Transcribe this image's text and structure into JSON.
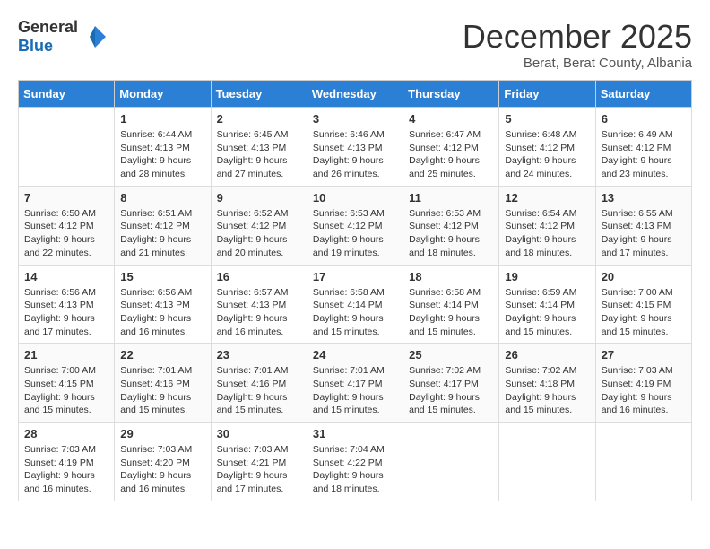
{
  "header": {
    "logo_general": "General",
    "logo_blue": "Blue",
    "title": "December 2025",
    "subtitle": "Berat, Berat County, Albania"
  },
  "weekdays": [
    "Sunday",
    "Monday",
    "Tuesday",
    "Wednesday",
    "Thursday",
    "Friday",
    "Saturday"
  ],
  "weeks": [
    [
      {
        "day": "",
        "empty": true
      },
      {
        "day": "1",
        "sunrise": "6:44 AM",
        "sunset": "4:13 PM",
        "daylight": "9 hours and 28 minutes."
      },
      {
        "day": "2",
        "sunrise": "6:45 AM",
        "sunset": "4:13 PM",
        "daylight": "9 hours and 27 minutes."
      },
      {
        "day": "3",
        "sunrise": "6:46 AM",
        "sunset": "4:13 PM",
        "daylight": "9 hours and 26 minutes."
      },
      {
        "day": "4",
        "sunrise": "6:47 AM",
        "sunset": "4:12 PM",
        "daylight": "9 hours and 25 minutes."
      },
      {
        "day": "5",
        "sunrise": "6:48 AM",
        "sunset": "4:12 PM",
        "daylight": "9 hours and 24 minutes."
      },
      {
        "day": "6",
        "sunrise": "6:49 AM",
        "sunset": "4:12 PM",
        "daylight": "9 hours and 23 minutes."
      }
    ],
    [
      {
        "day": "7",
        "sunrise": "6:50 AM",
        "sunset": "4:12 PM",
        "daylight": "9 hours and 22 minutes."
      },
      {
        "day": "8",
        "sunrise": "6:51 AM",
        "sunset": "4:12 PM",
        "daylight": "9 hours and 21 minutes."
      },
      {
        "day": "9",
        "sunrise": "6:52 AM",
        "sunset": "4:12 PM",
        "daylight": "9 hours and 20 minutes."
      },
      {
        "day": "10",
        "sunrise": "6:53 AM",
        "sunset": "4:12 PM",
        "daylight": "9 hours and 19 minutes."
      },
      {
        "day": "11",
        "sunrise": "6:53 AM",
        "sunset": "4:12 PM",
        "daylight": "9 hours and 18 minutes."
      },
      {
        "day": "12",
        "sunrise": "6:54 AM",
        "sunset": "4:12 PM",
        "daylight": "9 hours and 18 minutes."
      },
      {
        "day": "13",
        "sunrise": "6:55 AM",
        "sunset": "4:13 PM",
        "daylight": "9 hours and 17 minutes."
      }
    ],
    [
      {
        "day": "14",
        "sunrise": "6:56 AM",
        "sunset": "4:13 PM",
        "daylight": "9 hours and 17 minutes."
      },
      {
        "day": "15",
        "sunrise": "6:56 AM",
        "sunset": "4:13 PM",
        "daylight": "9 hours and 16 minutes."
      },
      {
        "day": "16",
        "sunrise": "6:57 AM",
        "sunset": "4:13 PM",
        "daylight": "9 hours and 16 minutes."
      },
      {
        "day": "17",
        "sunrise": "6:58 AM",
        "sunset": "4:14 PM",
        "daylight": "9 hours and 15 minutes."
      },
      {
        "day": "18",
        "sunrise": "6:58 AM",
        "sunset": "4:14 PM",
        "daylight": "9 hours and 15 minutes."
      },
      {
        "day": "19",
        "sunrise": "6:59 AM",
        "sunset": "4:14 PM",
        "daylight": "9 hours and 15 minutes."
      },
      {
        "day": "20",
        "sunrise": "7:00 AM",
        "sunset": "4:15 PM",
        "daylight": "9 hours and 15 minutes."
      }
    ],
    [
      {
        "day": "21",
        "sunrise": "7:00 AM",
        "sunset": "4:15 PM",
        "daylight": "9 hours and 15 minutes."
      },
      {
        "day": "22",
        "sunrise": "7:01 AM",
        "sunset": "4:16 PM",
        "daylight": "9 hours and 15 minutes."
      },
      {
        "day": "23",
        "sunrise": "7:01 AM",
        "sunset": "4:16 PM",
        "daylight": "9 hours and 15 minutes."
      },
      {
        "day": "24",
        "sunrise": "7:01 AM",
        "sunset": "4:17 PM",
        "daylight": "9 hours and 15 minutes."
      },
      {
        "day": "25",
        "sunrise": "7:02 AM",
        "sunset": "4:17 PM",
        "daylight": "9 hours and 15 minutes."
      },
      {
        "day": "26",
        "sunrise": "7:02 AM",
        "sunset": "4:18 PM",
        "daylight": "9 hours and 15 minutes."
      },
      {
        "day": "27",
        "sunrise": "7:03 AM",
        "sunset": "4:19 PM",
        "daylight": "9 hours and 16 minutes."
      }
    ],
    [
      {
        "day": "28",
        "sunrise": "7:03 AM",
        "sunset": "4:19 PM",
        "daylight": "9 hours and 16 minutes."
      },
      {
        "day": "29",
        "sunrise": "7:03 AM",
        "sunset": "4:20 PM",
        "daylight": "9 hours and 16 minutes."
      },
      {
        "day": "30",
        "sunrise": "7:03 AM",
        "sunset": "4:21 PM",
        "daylight": "9 hours and 17 minutes."
      },
      {
        "day": "31",
        "sunrise": "7:04 AM",
        "sunset": "4:22 PM",
        "daylight": "9 hours and 18 minutes."
      },
      {
        "day": "",
        "empty": true
      },
      {
        "day": "",
        "empty": true
      },
      {
        "day": "",
        "empty": true
      }
    ]
  ],
  "labels": {
    "sunrise": "Sunrise:",
    "sunset": "Sunset:",
    "daylight": "Daylight:"
  }
}
